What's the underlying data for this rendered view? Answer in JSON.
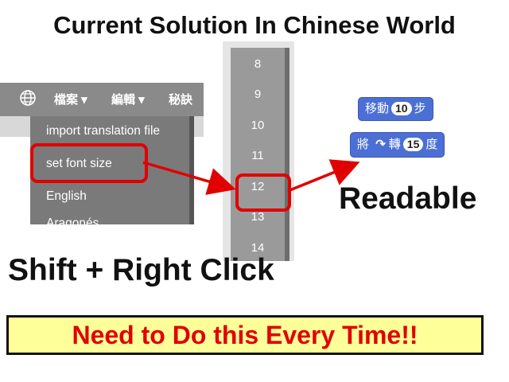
{
  "title": "Current Solution In Chinese World",
  "menu": {
    "bar_items": [
      "檔案 ▾",
      "編輯 ▾",
      "秘訣"
    ],
    "items": [
      "import translation file",
      "set font size",
      "English",
      "Aragonés"
    ]
  },
  "font_sizes": [
    "8",
    "9",
    "10",
    "11",
    "12",
    "13",
    "14"
  ],
  "selected_size": "12",
  "blocks": {
    "move": {
      "prefix": "移動",
      "value": "10",
      "suffix": "步"
    },
    "turn": {
      "prefix": "將",
      "verb": "轉",
      "value": "15",
      "suffix": "度"
    }
  },
  "readable_label": "Readable",
  "shortcut_label": "Shift + Right Click",
  "warning": "Need to Do this Every Time!!",
  "colors": {
    "highlight": "#e10000",
    "warning_bg": "#ffff99",
    "block": "#4c6fd6"
  }
}
